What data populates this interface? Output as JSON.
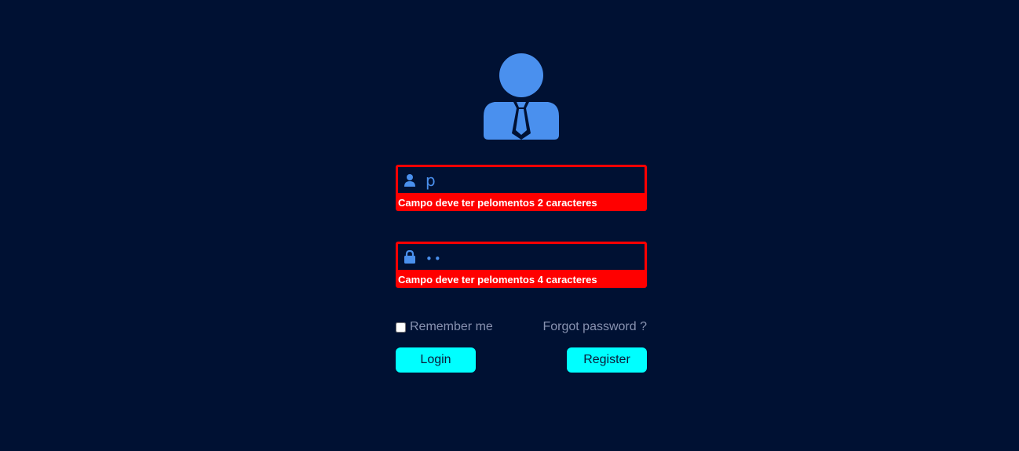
{
  "colors": {
    "background": "#001133",
    "icon": "#4a90ee",
    "error": "#ff0000",
    "button": "#00ffff",
    "muted_text": "#8892b0"
  },
  "avatar": {
    "icon": "user-tie-icon"
  },
  "username": {
    "icon": "user-icon",
    "value": "p",
    "error": "Campo deve ter pelomentos 2 caracteres"
  },
  "password": {
    "icon": "lock-icon",
    "value": "••",
    "error": "Campo deve ter pelomentos 4 caracteres"
  },
  "remember": {
    "label": "Remember me",
    "checked": false
  },
  "forgot": {
    "label": "Forgot password ?"
  },
  "buttons": {
    "login": "Login",
    "register": "Register"
  }
}
